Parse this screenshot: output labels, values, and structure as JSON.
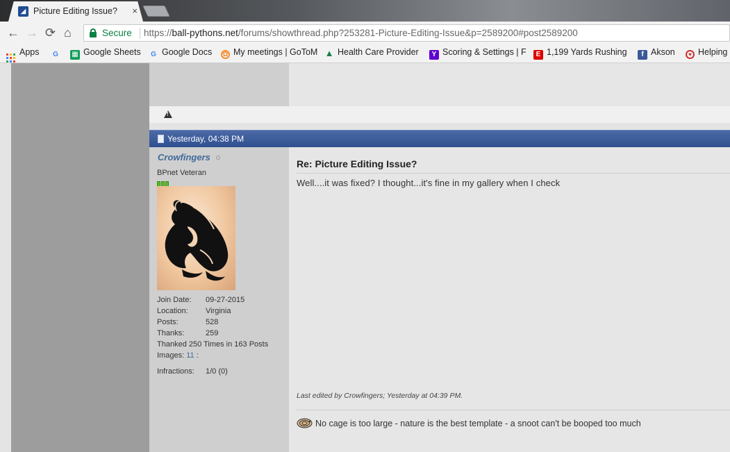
{
  "tab": {
    "title": "Picture Editing Issue?",
    "close": "×"
  },
  "toolbar": {
    "back": "←",
    "forward": "→",
    "reload": "⟳",
    "home": "⌂",
    "secure_label": "Secure",
    "url_scheme": "https://",
    "url_host": "ball-pythons.net",
    "url_path": "/forums/showthread.php?253281-Picture-Editing-Issue&p=2589200#post2589200"
  },
  "bookmarks": [
    {
      "label": "Apps"
    },
    {
      "label": ""
    },
    {
      "label": "Google Sheets"
    },
    {
      "label": "Google Docs"
    },
    {
      "label": "My meetings | GoToM"
    },
    {
      "label": "Health Care Provider"
    },
    {
      "label": "Scoring & Settings | F"
    },
    {
      "label": "1,199 Yards Rushing"
    },
    {
      "label": "Akson"
    },
    {
      "label": "Helping"
    }
  ],
  "post": {
    "date": "Yesterday, 04:38 PM",
    "user": {
      "name": "Crowfingers",
      "title": "BPnet Veteran",
      "stats": [
        {
          "key": "Join Date:",
          "value": "09-27-2015"
        },
        {
          "key": "Location:",
          "value": "Virginia"
        },
        {
          "key": "Posts:",
          "value": "528"
        },
        {
          "key": "Thanks:",
          "value": "259"
        }
      ],
      "thanked": "Thanked 250 Times in 163 Posts",
      "images_label": "Images:",
      "images_count": "11",
      "images_suffix": ":",
      "infractions_label": "Infractions:",
      "infractions_value": "1/0 (0)"
    },
    "title": "Re: Picture Editing Issue?",
    "message": "Well....it was fixed? I thought...it's fine in my gallery when I check",
    "last_edited": "Last edited by Crowfingers; Yesterday at 04:39 PM.",
    "signature": "No cage is too large - nature is the best template - a snoot can't be booped too much"
  }
}
